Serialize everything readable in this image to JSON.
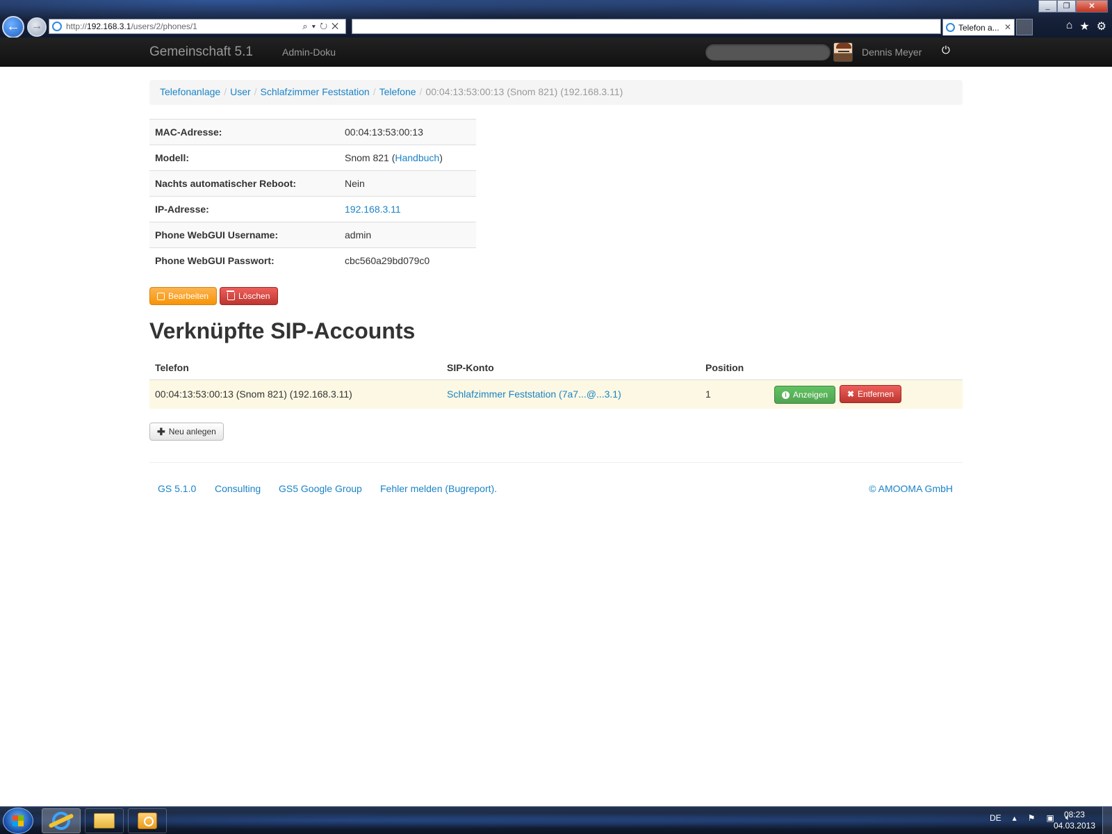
{
  "browser": {
    "url_prefix": "http://",
    "url_host": "192.168.3.1",
    "url_path": "/users/2/phones/1",
    "tab_title": "Telefon a...",
    "back_glyph": "←",
    "forward_glyph": "→"
  },
  "navbar": {
    "brand": "Gemeinschaft 5.1",
    "link": "Admin-Doku",
    "user_name": "Dennis Meyer",
    "logout_glyph": "⏻"
  },
  "breadcrumb": {
    "items": [
      "Telefonanlage",
      "User",
      "Schlafzimmer Feststation",
      "Telefone"
    ],
    "separator": "/",
    "active": "00:04:13:53:00:13 (Snom 821) (192.168.3.11)"
  },
  "details": {
    "rows": [
      {
        "label": "MAC-Adresse:",
        "value": "00:04:13:53:00:13"
      },
      {
        "label": "Modell:",
        "value": "Snom 821 (",
        "link": "Handbuch",
        "suffix": ")"
      },
      {
        "label": "Nachts automatischer Reboot:",
        "value": "Nein"
      },
      {
        "label": "IP-Adresse:",
        "link": "192.168.3.11"
      },
      {
        "label": "Phone WebGUI Username:",
        "value": "admin"
      },
      {
        "label": "Phone WebGUI Passwort:",
        "value": "cbc560a29bd079c0"
      }
    ]
  },
  "actions": {
    "edit_label": "Bearbeiten",
    "delete_label": "Löschen"
  },
  "sip_section": {
    "heading": "Verknüpfte SIP-Accounts",
    "columns": [
      "Telefon",
      "SIP-Konto",
      "Position"
    ],
    "rows": [
      {
        "telefon": "00:04:13:53:00:13 (Snom 821) (192.168.3.11)",
        "sip_konto": "Schlafzimmer Feststation (7a7...@...3.1)",
        "position": "1",
        "show_label": "Anzeigen",
        "remove_label": "Entfernen"
      }
    ],
    "new_label": "Neu anlegen"
  },
  "footer": {
    "links": [
      "GS 5.1.0",
      "Consulting",
      "GS5 Google Group",
      "Fehler melden (Bugreport)."
    ],
    "copyright": "© AMOOMA GmbH"
  },
  "taskbar": {
    "language": "DE",
    "time": "08:23",
    "date": "04.03.2013"
  },
  "colors": {
    "link": "#1a83c6",
    "warning": "#f89406",
    "danger": "#bd362f",
    "success": "#51a351",
    "row_highlight": "#fcf8e3"
  }
}
